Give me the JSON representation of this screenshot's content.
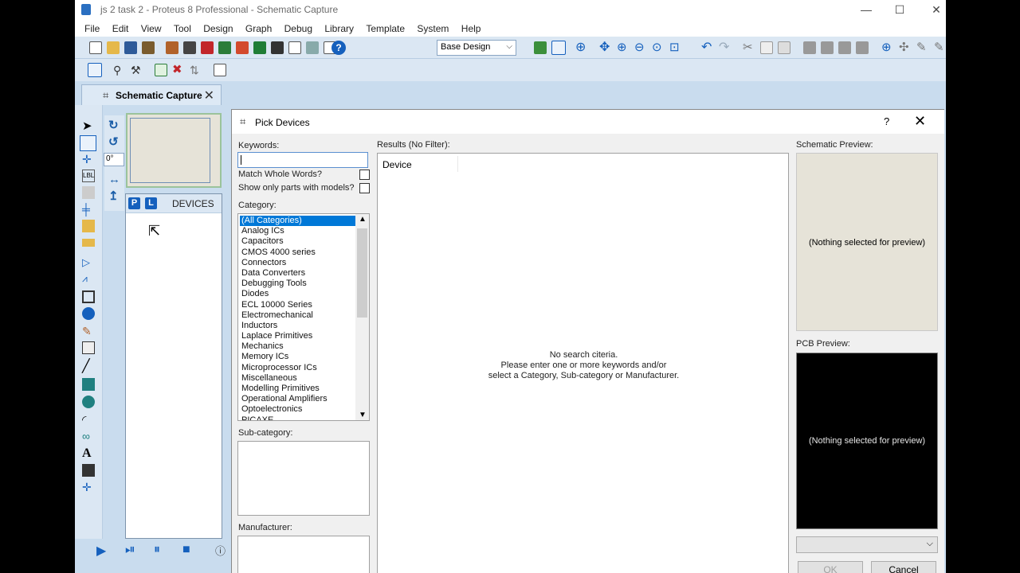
{
  "window": {
    "title": "js 2 task 2 - Proteus 8 Professional - Schematic Capture",
    "minimize": "—",
    "maximize": "☐",
    "close": "✕"
  },
  "menu": [
    "File",
    "Edit",
    "View",
    "Tool",
    "Design",
    "Graph",
    "Debug",
    "Library",
    "Template",
    "System",
    "Help"
  ],
  "toolbar": {
    "design_select": "Base Design"
  },
  "tab": {
    "label": "Schematic Capture"
  },
  "rotation": {
    "angle": "0°"
  },
  "device_panel": {
    "p_button": "P",
    "l_button": "L",
    "title": "DEVICES"
  },
  "dialog": {
    "title": "Pick Devices",
    "help": "?",
    "close": "✕",
    "keywords_label": "Keywords:",
    "keywords_value": "",
    "match_whole_words": "Match Whole Words?",
    "show_only_models": "Show only parts with models?",
    "category_label": "Category:",
    "categories": [
      "(All Categories)",
      "Analog ICs",
      "Capacitors",
      "CMOS 4000 series",
      "Connectors",
      "Data Converters",
      "Debugging Tools",
      "Diodes",
      "ECL 10000 Series",
      "Electromechanical",
      "Inductors",
      "Laplace Primitives",
      "Mechanics",
      "Memory ICs",
      "Microprocessor ICs",
      "Miscellaneous",
      "Modelling Primitives",
      "Operational Amplifiers",
      "Optoelectronics",
      "PICAXE"
    ],
    "selected_category": "(All Categories)",
    "subcategory_label": "Sub-category:",
    "manufacturer_label": "Manufacturer:",
    "results_label": "Results (No Filter):",
    "results_column": "Device",
    "no_search_line1": "No search citeria.",
    "no_search_line2": "Please enter one or more keywords and/or",
    "no_search_line3": "select a Category, Sub-category or Manufacturer.",
    "schematic_preview_label": "Schematic Preview:",
    "schematic_preview_text": "(Nothing selected for preview)",
    "pcb_preview_label": "PCB Preview:",
    "pcb_preview_text": "(Nothing selected for preview)",
    "ok": "OK",
    "cancel": "Cancel"
  },
  "colors": {
    "app_bg": "#c9dcee",
    "accent": "#1560bd",
    "selection": "#0078d7",
    "preview_bg": "#e6e3d8"
  }
}
